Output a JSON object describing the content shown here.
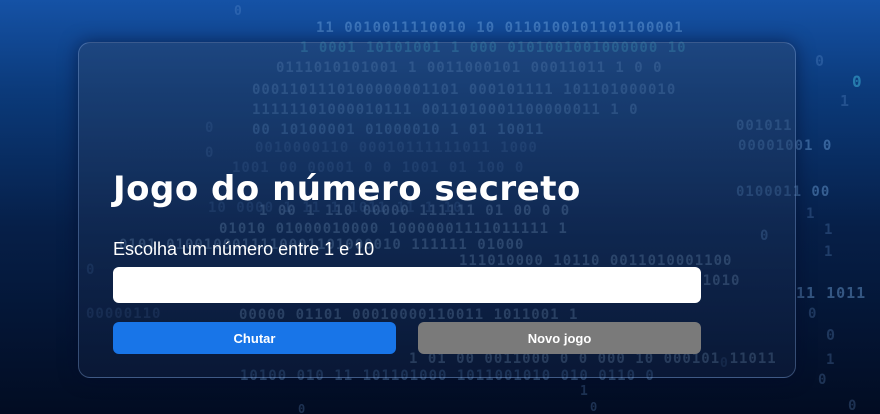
{
  "game": {
    "title": "Jogo do número secreto",
    "prompt": "Escolha um número entre 1 e 10",
    "input_value": "",
    "input_placeholder": "",
    "guess_button_label": "Chutar",
    "new_game_button_label": "Novo jogo"
  },
  "colors": {
    "guess_button": "#1875e8",
    "new_game_button": "#7a7a7a",
    "background_top": "#1552a6",
    "background_bottom": "#020c22"
  }
}
